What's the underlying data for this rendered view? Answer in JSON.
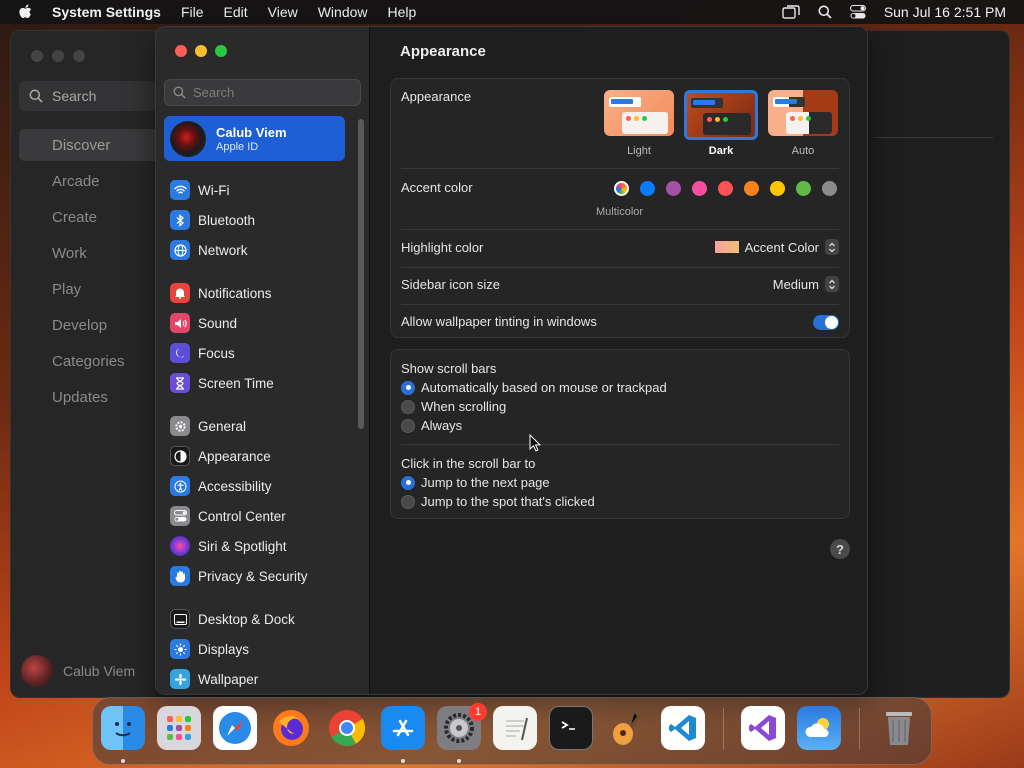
{
  "menubar": {
    "app": "System Settings",
    "items": [
      "File",
      "Edit",
      "View",
      "Window",
      "Help"
    ],
    "datetime": "Sun Jul 16  2:51 PM"
  },
  "bg_window": {
    "search_label": "Search",
    "nav": [
      "Discover",
      "Arcade",
      "Create",
      "Work",
      "Play",
      "Develop",
      "Categories",
      "Updates"
    ],
    "user": "Calub Viem"
  },
  "sidebar": {
    "search_placeholder": "Search",
    "account": {
      "name": "Calub Viem",
      "sub": "Apple ID"
    },
    "items": [
      {
        "label": "Wi-Fi",
        "icon": "wifi-icon",
        "color": "#2a7ae2"
      },
      {
        "label": "Bluetooth",
        "icon": "bluetooth-icon",
        "color": "#2a7ae2"
      },
      {
        "label": "Network",
        "icon": "globe-icon",
        "color": "#2a7ae2"
      },
      {
        "label": "Notifications",
        "icon": "bell-icon",
        "color": "#e5453a"
      },
      {
        "label": "Sound",
        "icon": "speaker-icon",
        "color": "#e5456a"
      },
      {
        "label": "Focus",
        "icon": "moon-icon",
        "color": "#5b4fd6"
      },
      {
        "label": "Screen Time",
        "icon": "hourglass-icon",
        "color": "#6a4fd6"
      },
      {
        "label": "General",
        "icon": "gear-icon",
        "color": "#8a8a8e"
      },
      {
        "label": "Appearance",
        "icon": "appearance-icon",
        "color": "#1a1a1a"
      },
      {
        "label": "Accessibility",
        "icon": "accessibility-icon",
        "color": "#2a7ae2"
      },
      {
        "label": "Control Center",
        "icon": "control-center-icon",
        "color": "#8a8a8e"
      },
      {
        "label": "Siri & Spotlight",
        "icon": "siri-icon",
        "color": "#9a3ad6"
      },
      {
        "label": "Privacy & Security",
        "icon": "hand-icon",
        "color": "#2a7ae2"
      },
      {
        "label": "Desktop & Dock",
        "icon": "dock-icon",
        "color": "#1a1a1a"
      },
      {
        "label": "Displays",
        "icon": "sun-icon",
        "color": "#2a7ae2"
      },
      {
        "label": "Wallpaper",
        "icon": "wallpaper-icon",
        "color": "#36a3e0"
      }
    ]
  },
  "content": {
    "title": "Appearance",
    "appearance_label": "Appearance",
    "modes": [
      "Light",
      "Dark",
      "Auto"
    ],
    "selected_mode": "Dark",
    "accent_label": "Accent color",
    "accent_caption": "Multicolor",
    "accent_colors": [
      "#0a7aff",
      "#a550a7",
      "#f74f9e",
      "#ff5257",
      "#f7821b",
      "#ffc600",
      "#62ba46",
      "#8c8c8c"
    ],
    "highlight_label": "Highlight color",
    "highlight_value": "Accent Color",
    "sidebar_icon_label": "Sidebar icon size",
    "sidebar_icon_value": "Medium",
    "tinting_label": "Allow wallpaper tinting in windows",
    "tinting_on": true,
    "scroll_title": "Show scroll bars",
    "scroll_options": [
      "Automatically based on mouse or trackpad",
      "When scrolling",
      "Always"
    ],
    "click_title": "Click in the scroll bar to",
    "click_options": [
      "Jump to the next page",
      "Jump to the spot that's clicked"
    ],
    "help": "?"
  },
  "dock": {
    "badge": "1",
    "apps": [
      "finder-icon",
      "launchpad-icon",
      "safari-icon",
      "firefox-icon",
      "chrome-icon",
      "app-store-icon",
      "system-settings-icon",
      "textedit-icon",
      "terminal-icon",
      "garageband-icon",
      "vscode-icon",
      "visual-studio-icon",
      "weather-icon",
      "trash-icon"
    ]
  }
}
